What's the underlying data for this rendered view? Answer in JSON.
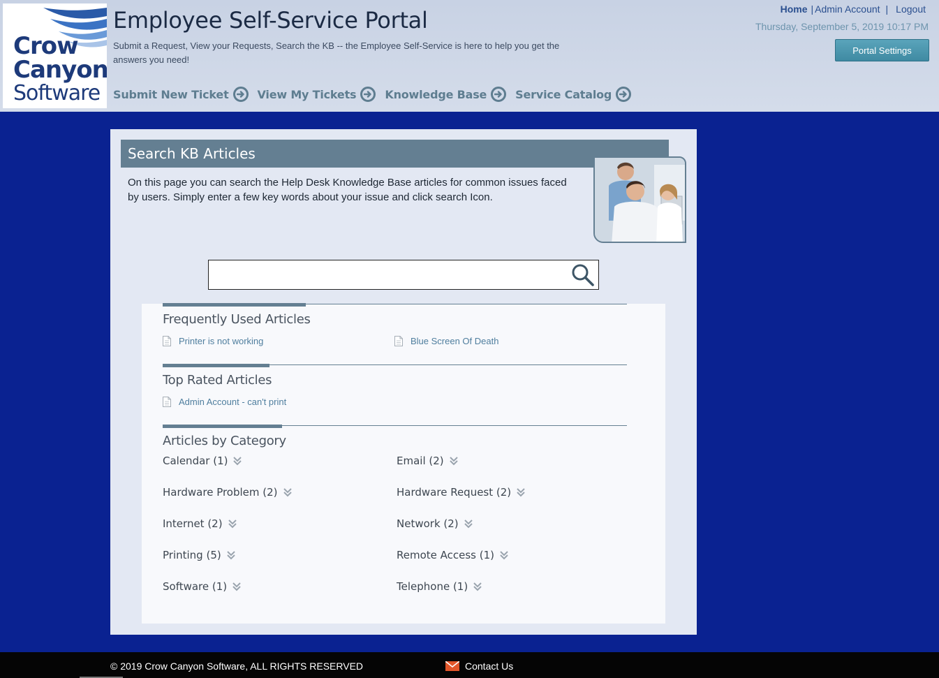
{
  "header": {
    "logo": {
      "line1": "Crow",
      "line2": "Canyon",
      "line3": "Software"
    },
    "title": "Employee Self-Service Portal",
    "subtitle": "Submit a Request, View your Requests, Search the KB -- the Employee Self-Service is here to help you get the answers you need!",
    "nav": [
      {
        "label": "Submit New Ticket",
        "icon": "arrow-right-circle-icon"
      },
      {
        "label": "View My Tickets",
        "icon": "arrow-right-circle-icon"
      },
      {
        "label": "Knowledge Base",
        "icon": "arrow-right-circle-icon"
      },
      {
        "label": "Service Catalog",
        "icon": "arrow-right-circle-icon"
      }
    ],
    "toplinks": {
      "home": "Home",
      "sep1": "|",
      "account": "Admin Account",
      "sep2": "|",
      "logout": "Logout"
    },
    "datetime": "Thursday, September 5, 2019 10:17 PM",
    "portal_settings": "Portal Settings"
  },
  "kb": {
    "title": "Search KB Articles",
    "description": "On this page you can search the Help Desk Knowledge Base articles for common issues faced by users. Simply enter a few key words about your issue and click search Icon.",
    "search_value": "",
    "search_placeholder": ""
  },
  "sections": {
    "frequent": {
      "title": "Frequently Used Articles",
      "articles": [
        "Printer is not working",
        "Blue Screen Of Death"
      ]
    },
    "top_rated": {
      "title": "Top Rated Articles",
      "articles": [
        "Admin Account - can't print"
      ]
    },
    "categories": {
      "title": "Articles by Category",
      "items": [
        "Calendar (1)",
        "Email (2)",
        "Hardware Problem (2)",
        "Hardware Request (2)",
        "Internet (2)",
        "Network (2)",
        "Printing (5)",
        "Remote Access (1)",
        "Software (1)",
        "Telephone (1)"
      ]
    }
  },
  "footer": {
    "copyright": "© 2019 Crow Canyon Software, ALL RIGHTS RESERVED",
    "contact": "Contact Us"
  },
  "colors": {
    "page_bg": "#0a2291",
    "header_bg": "#c8d2e4",
    "accent": "#647f92",
    "link": "#4f7e9e",
    "button": "#4a97af"
  }
}
